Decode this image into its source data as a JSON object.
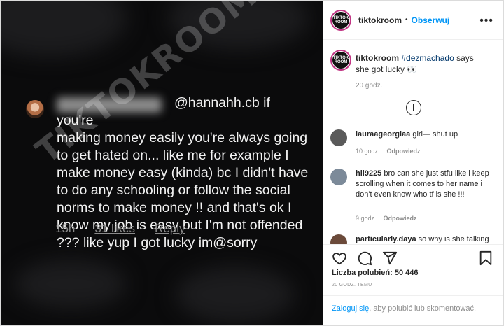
{
  "media": {
    "comment_text": "@hannahh.cb if you're\nmaking money easily you're always going\nto get hated on... like me for example I\nmake money easy (kinda) bc I didn't have\nto do any schooling or follow the social\nnorms to make money !! and that's ok I\nknow my job is easy but I'm not offended\n??? like yup I got lucky im@sorry",
    "comment_age": "15h",
    "comment_likes": "31 likes",
    "comment_reply": "Reply",
    "watermark": "TIKTOKROOM"
  },
  "header": {
    "avatar_text": "TIKTOK ROOM",
    "username": "tiktokroom",
    "dot": "•",
    "follow": "Obserwuj",
    "more": "•••"
  },
  "caption": {
    "username": "tiktokroom",
    "hashtag": "#dezmachado",
    "text": " says she got lucky 👀",
    "time": "20 godz."
  },
  "comments": [
    {
      "username": "lauraageorgiaa",
      "text": " girl— shut up",
      "time": "10 godz.",
      "reply": "Odpowiedz",
      "avatar_color": "#5a5a5a"
    },
    {
      "username": "hii9225",
      "text": " bro can she just stfu like i keep scrolling when it comes to her name i don't even know who tf is she !!!",
      "time": "9 godz.",
      "reply": "Odpowiedz",
      "avatar_color": "#7c8a99"
    },
    {
      "username": "particularly.daya",
      "text": " so why is she talking",
      "avatar_color": "#6b4a3a"
    }
  ],
  "actions": {
    "likes": "Liczba polubień: 50 446",
    "post_time": "20 GODZ. TEMU",
    "login_link": "Zaloguj się",
    "login_rest": ", aby polubić lub skomentować."
  },
  "colors": {
    "accent": "#0095f6",
    "ring": "#c13584"
  }
}
